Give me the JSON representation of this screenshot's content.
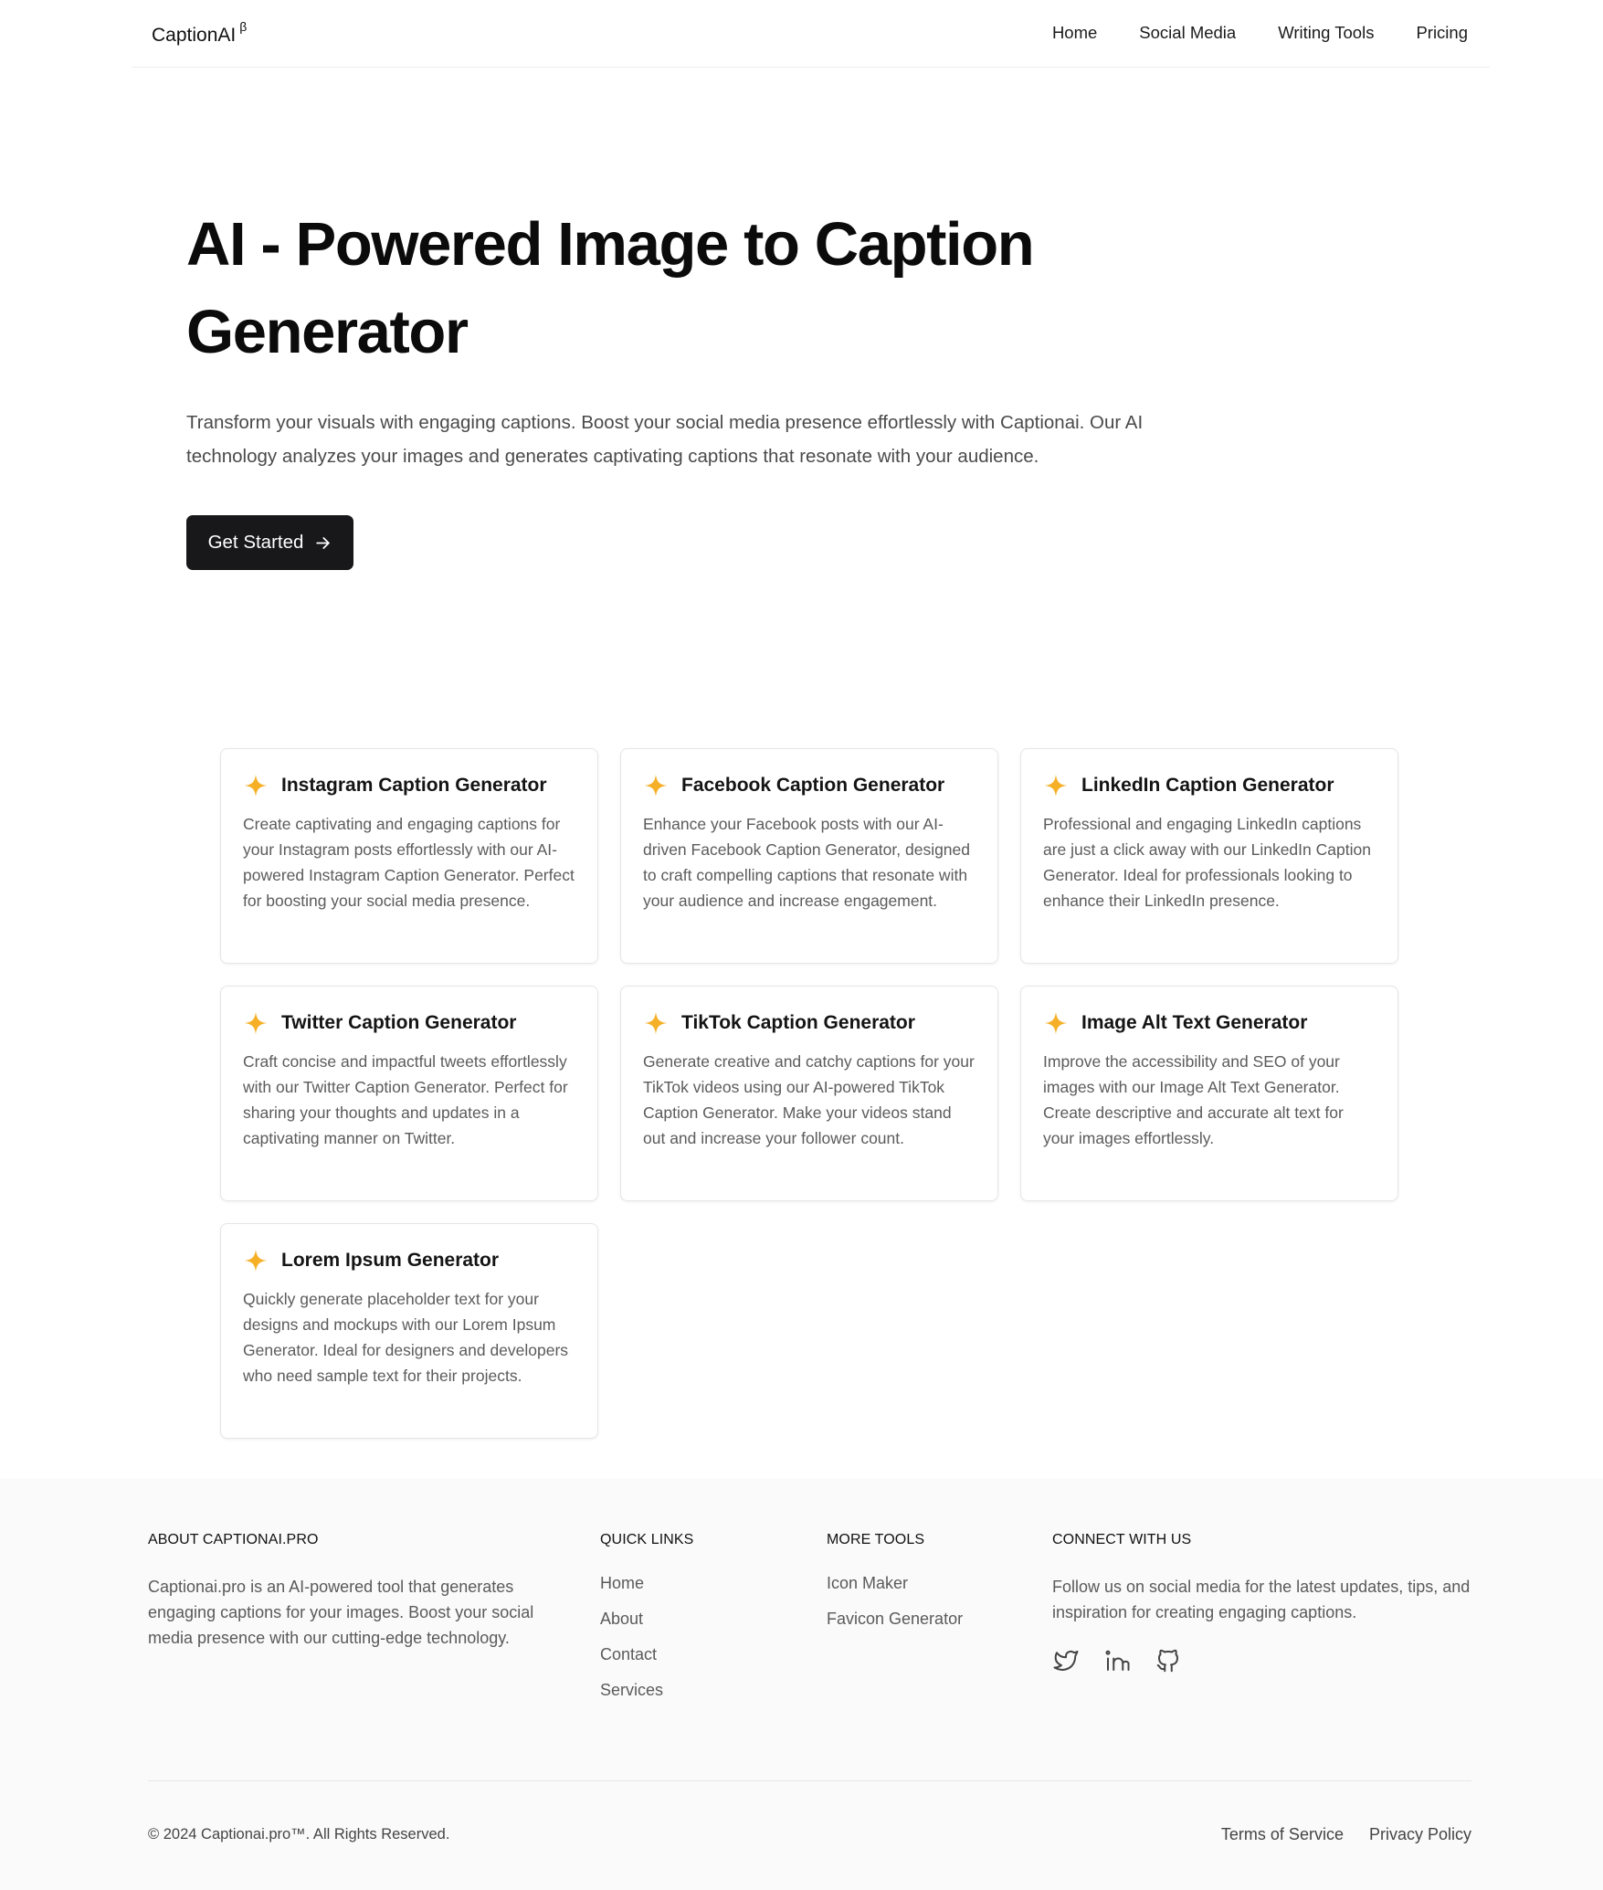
{
  "header": {
    "logo": "CaptionAI",
    "logo_badge": "β",
    "nav": [
      "Home",
      "Social Media",
      "Writing Tools",
      "Pricing"
    ]
  },
  "hero": {
    "title_line1": "AI - Powered Image to Caption",
    "title_line2": "Generator",
    "description": "Transform your visuals with engaging captions. Boost your social media presence effortlessly with Captionai. Our AI technology analyzes your images and generates captivating captions that resonate with your audience.",
    "cta_label": "Get Started"
  },
  "colors": {
    "accent": "#f5b027",
    "button_bg": "#18181b",
    "footer_bg": "#fafafa"
  },
  "cards": [
    {
      "icon": "sparkle-icon",
      "title": "Instagram Caption Generator",
      "description": "Create captivating and engaging captions for your Instagram posts effortlessly with our AI-powered Instagram Caption Generator. Perfect for boosting your social media presence."
    },
    {
      "icon": "sparkle-icon",
      "title": "Facebook Caption Generator",
      "description": "Enhance your Facebook posts with our AI-driven Facebook Caption Generator, designed to craft compelling captions that resonate with your audience and increase engagement."
    },
    {
      "icon": "sparkle-icon",
      "title": "LinkedIn Caption Generator",
      "description": "Professional and engaging LinkedIn captions are just a click away with our LinkedIn Caption Generator. Ideal for professionals looking to enhance their LinkedIn presence."
    },
    {
      "icon": "sparkle-icon",
      "title": "Twitter Caption Generator",
      "description": "Craft concise and impactful tweets effortlessly with our Twitter Caption Generator. Perfect for sharing your thoughts and updates in a captivating manner on Twitter."
    },
    {
      "icon": "sparkle-icon",
      "title": "TikTok Caption Generator",
      "description": "Generate creative and catchy captions for your TikTok videos using our AI-powered TikTok Caption Generator. Make your videos stand out and increase your follower count."
    },
    {
      "icon": "sparkle-icon",
      "title": "Image Alt Text Generator",
      "description": "Improve the accessibility and SEO of your images with our Image Alt Text Generator. Create descriptive and accurate alt text for your images effortlessly."
    },
    {
      "icon": "sparkle-icon",
      "title": "Lorem Ipsum Generator",
      "description": "Quickly generate placeholder text for your designs and mockups with our Lorem Ipsum Generator. Ideal for designers and developers who need sample text for their projects."
    }
  ],
  "footer": {
    "about": {
      "heading": "ABOUT CAPTIONAI.PRO",
      "text": "Captionai.pro is an AI-powered tool that generates engaging captions for your images. Boost your social media presence with our cutting-edge technology."
    },
    "quick_links": {
      "heading": "QUICK LINKS",
      "links": [
        "Home",
        "About",
        "Contact",
        "Services"
      ]
    },
    "more_tools": {
      "heading": "MORE TOOLS",
      "links": [
        "Icon Maker",
        "Favicon Generator"
      ]
    },
    "connect": {
      "heading": "CONNECT WITH US",
      "text": "Follow us on social media for the latest updates, tips, and inspiration for creating engaging captions.",
      "icons": [
        "twitter-icon",
        "linkedin-icon",
        "github-icon"
      ]
    },
    "copyright": "© 2024 Captionai.pro™. All Rights Reserved.",
    "legal": [
      "Terms of Service",
      "Privacy Policy"
    ]
  }
}
